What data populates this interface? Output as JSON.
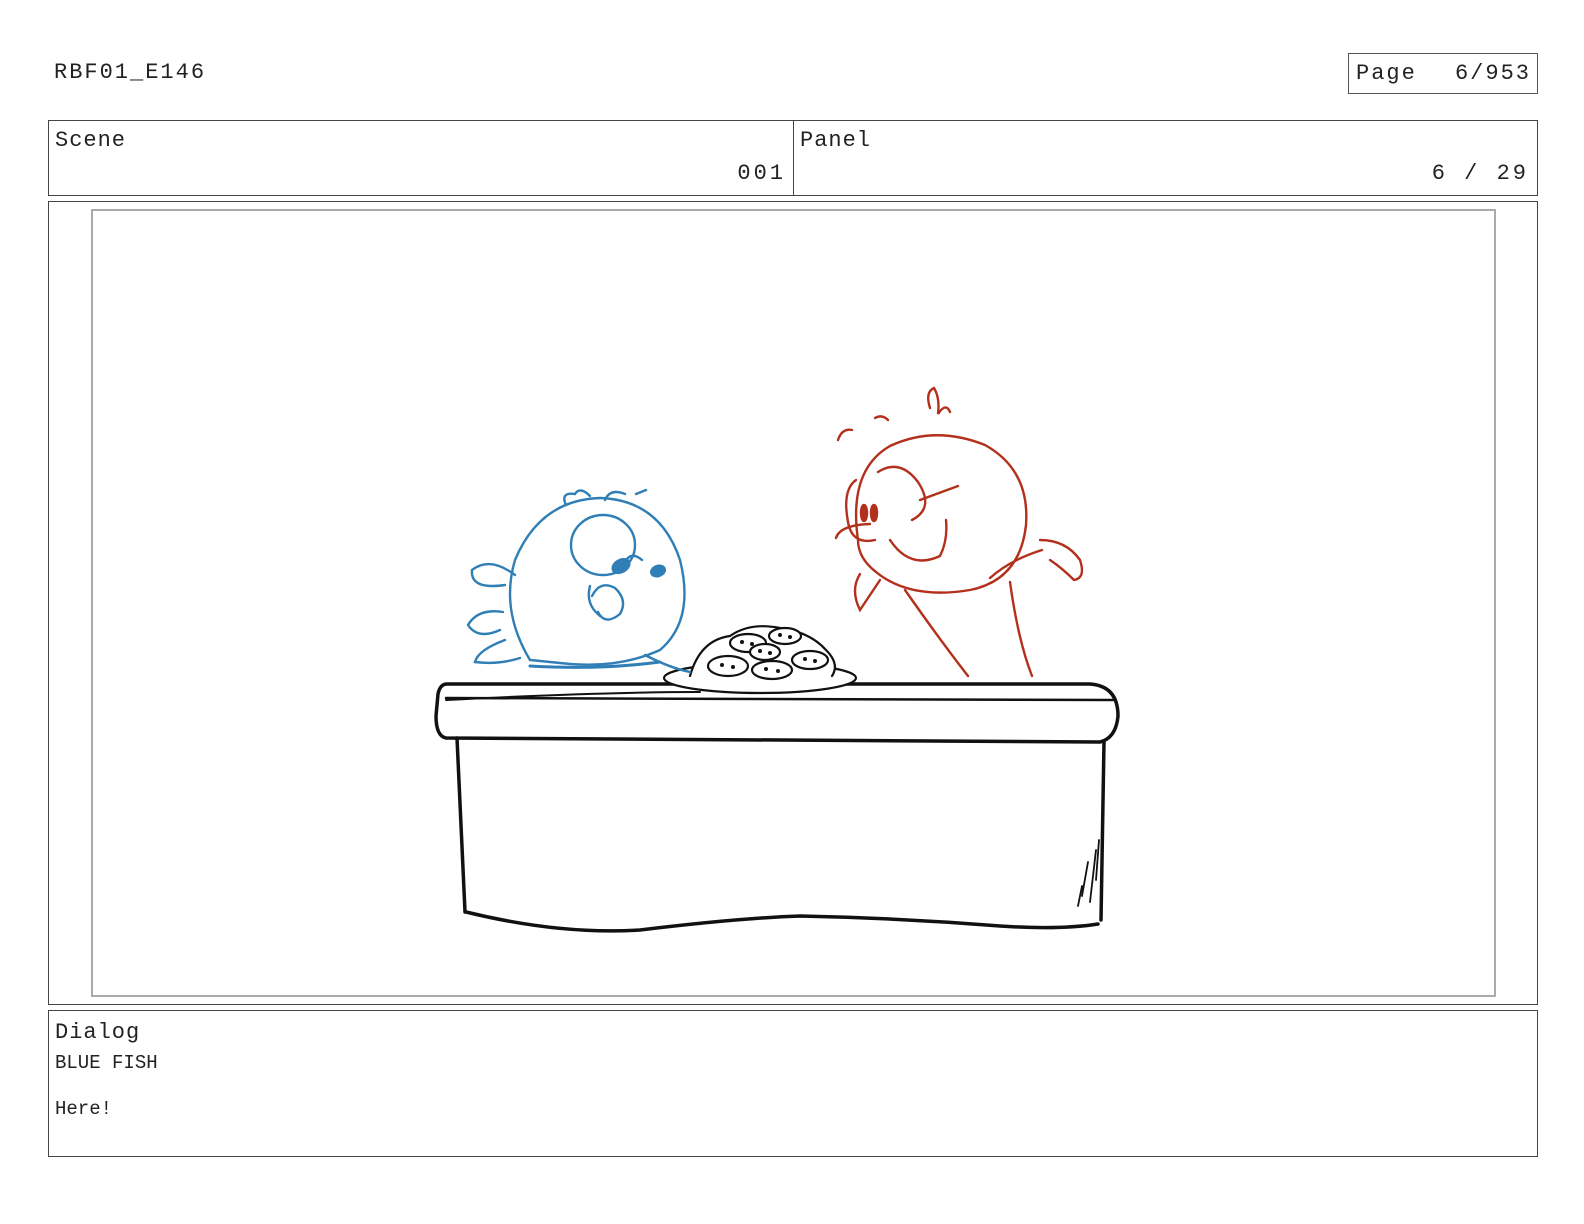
{
  "header": {
    "doc_id": "RBF01_E146",
    "page_label": "Page",
    "page_value": "6/953"
  },
  "scene": {
    "label": "Scene",
    "value": "001"
  },
  "panel": {
    "label": "Panel",
    "value": "6 / 29"
  },
  "dialog": {
    "label": "Dialog",
    "speaker": "BLUE FISH",
    "line": "Here!"
  },
  "colors": {
    "blue_fish": "#2f7fb6",
    "red_fish": "#b3301c",
    "ink": "#111111"
  }
}
